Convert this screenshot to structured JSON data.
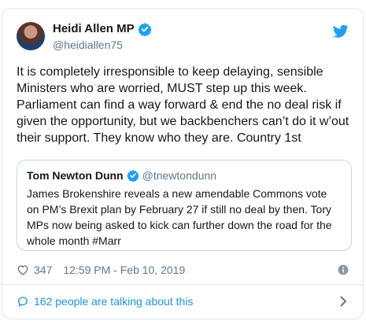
{
  "tweet": {
    "author_name": "Heidi Allen MP",
    "handle": "@heidiallen75",
    "text": "It is completely irresponsible to keep delaying, sensible Ministers who are worried, MUST step up this week. Parliament can find a way forward & end the no deal risk if given the opportunity, but we backbenchers can’t do it w’out their support. They know who they are. Country 1st",
    "likes": "347",
    "timestamp": "12:59 PM - Feb 10, 2019"
  },
  "quoted": {
    "author_name": "Tom Newton Dunn",
    "handle": "@tnewtondunn",
    "text": "James Brokenshire reveals a new amendable Commons vote on PM’s Brexit plan by February 27 if still no deal by then. Tory MPs now being asked to kick can further down the road for the whole month #Marr"
  },
  "footer": {
    "talking_label": "162 people are talking about this"
  },
  "colors": {
    "accent": "#1da1f2",
    "link": "#1b95e0",
    "muted": "#657786",
    "text": "#14171a",
    "border": "#e1e8ed"
  },
  "icons": [
    "twitter-bird-icon",
    "verified-badge-icon",
    "heart-icon",
    "info-icon",
    "speech-bubble-icon",
    "chevron-right-icon"
  ]
}
